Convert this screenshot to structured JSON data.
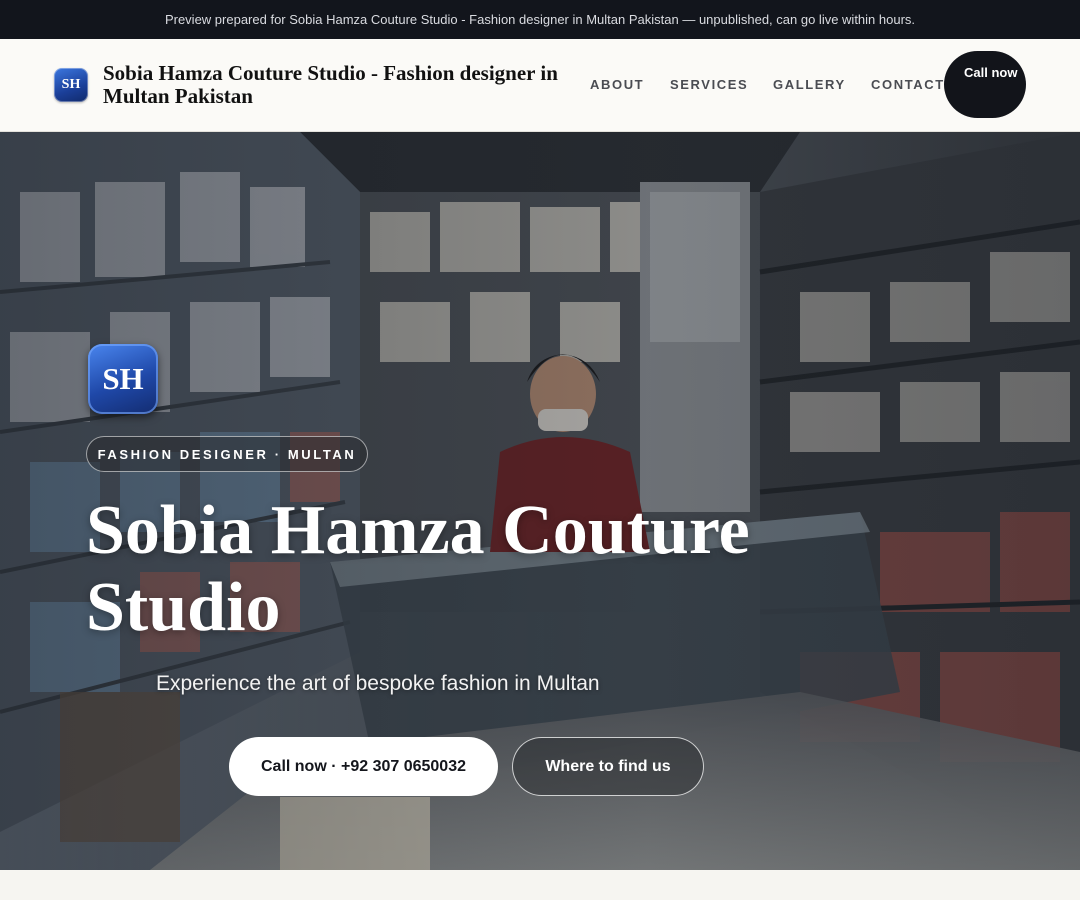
{
  "banner": {
    "text": "Preview prepared for Sobia Hamza Couture Studio - Fashion designer in Multan Pakistan — unpublished, can go live within hours."
  },
  "header": {
    "logo_initials": "SH",
    "brand": "Sobia Hamza Couture Studio - Fashion designer in Multan Pakistan",
    "nav": [
      "ABOUT",
      "SERVICES",
      "GALLERY",
      "CONTACT"
    ],
    "call_button": "Call now"
  },
  "hero": {
    "logo_initials": "SH",
    "eyebrow": "FASHION DESIGNER · MULTAN",
    "title": "Sobia Hamza Couture Studio",
    "subtitle": "Experience the art of bespoke fashion in Multan",
    "primary_cta": "Call now · +92 307 0650032",
    "secondary_cta": "Where to find us",
    "background_image": "shop-interior-photo"
  },
  "colors": {
    "banner_bg": "#12151c",
    "header_bg": "#fbfaf7",
    "accent_blue": "#1f48a8",
    "dark_button": "#12141a"
  }
}
